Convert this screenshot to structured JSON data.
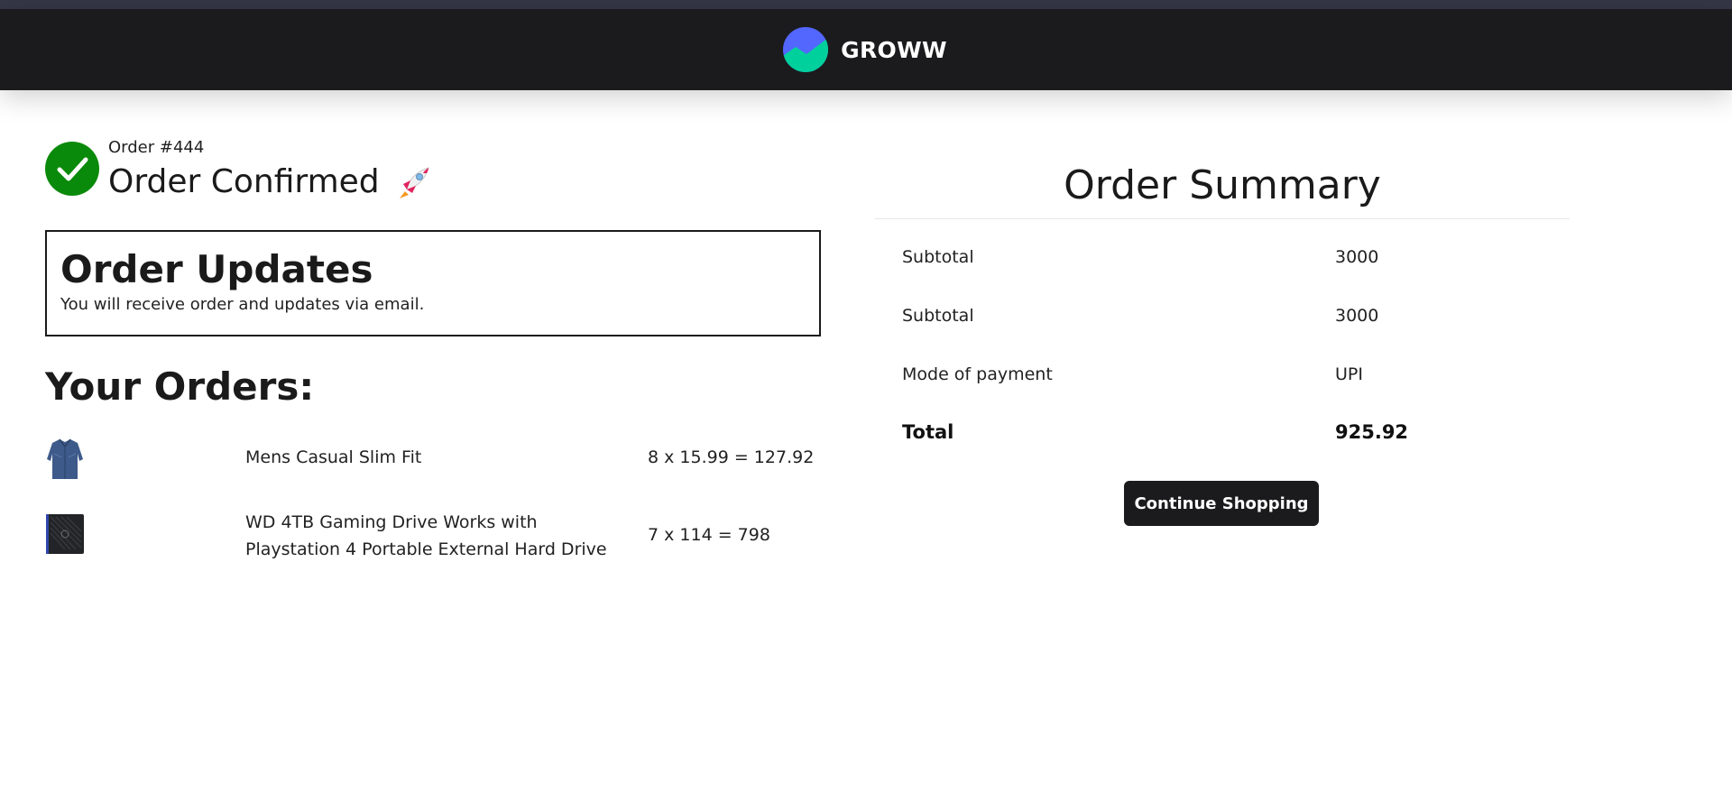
{
  "brand": {
    "name": "GROWW"
  },
  "order": {
    "number_label": "Order #444",
    "status_title": "Order Confirmed",
    "status_icon": "check-icon",
    "rocket_icon": "rocket-icon"
  },
  "updates": {
    "title": "Order Updates",
    "text": "You will receive order and updates via email."
  },
  "orders": {
    "heading": "Your Orders:",
    "items": [
      {
        "name": "Mens Casual Slim Fit",
        "calc": "8 x 15.99 = 127.92",
        "thumb": "shirt-thumbnail"
      },
      {
        "name": "WD 4TB Gaming Drive Works with Playstation 4 Portable External Hard Drive",
        "calc": "7 x 114 = 798",
        "thumb": "hard-drive-thumbnail"
      }
    ]
  },
  "summary": {
    "title": "Order Summary",
    "rows": [
      {
        "label": "Subtotal",
        "value": "3000"
      },
      {
        "label": "Subtotal",
        "value": "3000"
      },
      {
        "label": "Mode of payment",
        "value": "UPI"
      }
    ],
    "total": {
      "label": "Total",
      "value": "925.92"
    },
    "continue_label": "Continue Shopping"
  },
  "colors": {
    "navbar_bg": "#1b1b1d",
    "top_strip": "#353646",
    "success_green": "#0a8a0a",
    "logo_blue": "#5367ff",
    "logo_teal": "#00d09c",
    "button_bg": "#1b1b1d"
  }
}
